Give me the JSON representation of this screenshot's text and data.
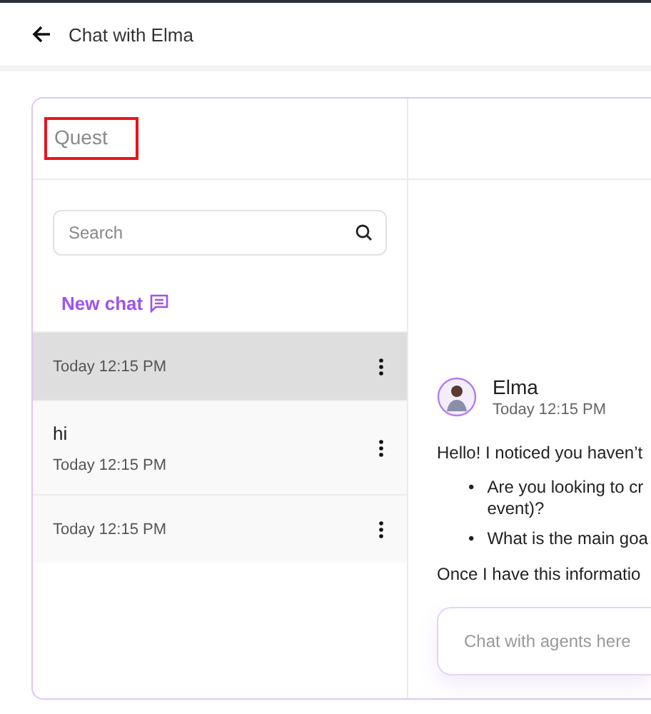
{
  "header": {
    "title": "Chat with Elma"
  },
  "sidebar": {
    "title": "Quest",
    "search": {
      "placeholder": "Search"
    },
    "new_chat": "New chat",
    "chats": [
      {
        "time": "Today 12:15 PM",
        "selected": true
      },
      {
        "title": "hi",
        "time": "Today 12:15 PM",
        "selected": false
      },
      {
        "time": "Today 12:15 PM",
        "selected": false
      }
    ]
  },
  "conversation": {
    "message": {
      "sender": "Elma",
      "time": "Today 12:15 PM",
      "intro": "Hello! I noticed you haven’t",
      "bullets": [
        {
          "marker": "•",
          "lines": [
            "Are you looking to cr",
            "event)?"
          ]
        },
        {
          "marker": "•",
          "lines": [
            "What is the main goa"
          ]
        }
      ],
      "outro": "Once I have this informatio"
    },
    "composer": {
      "placeholder": "Chat with agents here"
    }
  }
}
